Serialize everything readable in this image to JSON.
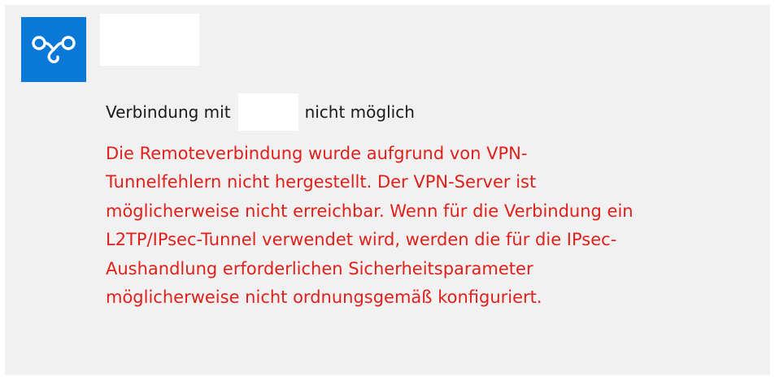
{
  "connection": {
    "icon": "vpn-icon",
    "icon_color": "#0a78d7",
    "status_prefix": "Verbindung mit",
    "status_suffix": "nicht möglich"
  },
  "error": {
    "color": "#e0201b",
    "message": "Die Remoteverbindung wurde aufgrund von VPN-\nTunnelfehlern nicht hergestellt. Der VPN-Server ist\nmöglicherweise nicht erreichbar. Wenn für die Verbindung ein\nL2TP/IPsec-Tunnel verwendet wird, werden die für die IPsec-\nAushandlung erforderlichen Sicherheitsparameter\nmöglicherweise nicht ordnungsgemäß konfiguriert."
  }
}
